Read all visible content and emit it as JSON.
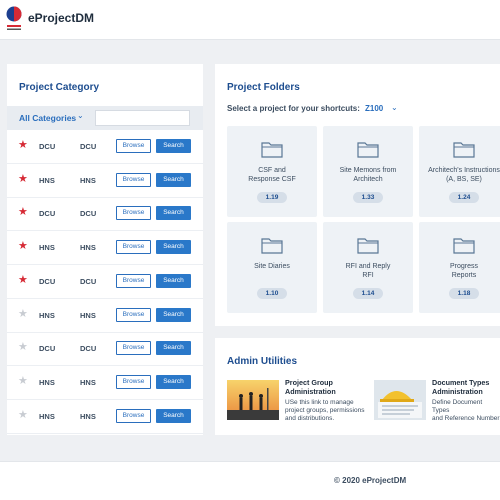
{
  "header": {
    "app_title": "eProjectDM"
  },
  "category": {
    "title": "Project Category",
    "filter_label": "All Categories",
    "filter_placeholder": "",
    "browse_label": "Browse",
    "search_label": "Search",
    "rows": [
      {
        "starred": true,
        "col1": "DCU",
        "col2": "DCU"
      },
      {
        "starred": true,
        "col1": "HNS",
        "col2": "HNS"
      },
      {
        "starred": true,
        "col1": "DCU",
        "col2": "DCU"
      },
      {
        "starred": true,
        "col1": "HNS",
        "col2": "HNS"
      },
      {
        "starred": true,
        "col1": "DCU",
        "col2": "DCU"
      },
      {
        "starred": false,
        "col1": "HNS",
        "col2": "HNS"
      },
      {
        "starred": false,
        "col1": "DCU",
        "col2": "DCU"
      },
      {
        "starred": false,
        "col1": "HNS",
        "col2": "HNS"
      },
      {
        "starred": false,
        "col1": "HNS",
        "col2": "HNS"
      }
    ]
  },
  "folders": {
    "title": "Project Folders",
    "select_label": "Select a project for your shortcuts:",
    "selected_project": "Z100",
    "cards": [
      {
        "label": "CSF and\nResponse CSF",
        "badge": "1.19"
      },
      {
        "label": "Site Memons from\nArchitech",
        "badge": "1.33"
      },
      {
        "label": "Architech's Instructions\n(A, BS, SE)",
        "badge": "1.24"
      },
      {
        "label": "Site Diaries",
        "badge": "1.10"
      },
      {
        "label": "RFI and Reply\nRFI",
        "badge": "1.14"
      },
      {
        "label": "Progress\nReports",
        "badge": "1.18"
      }
    ]
  },
  "admin": {
    "title": "Admin Utilities",
    "items": [
      {
        "title": "Project Group\nAdministration",
        "desc": "USe this link to manage\nproject groups, permissions\nand distributions."
      },
      {
        "title": "Document Types\nAdministration",
        "desc": "Define Document Types\nand Reference Number"
      }
    ]
  },
  "footer": {
    "copyright": "© 2020 eProjectDM"
  },
  "colors": {
    "accent": "#2a78c9",
    "title": "#1d4d8f",
    "star": "#d62a35"
  }
}
